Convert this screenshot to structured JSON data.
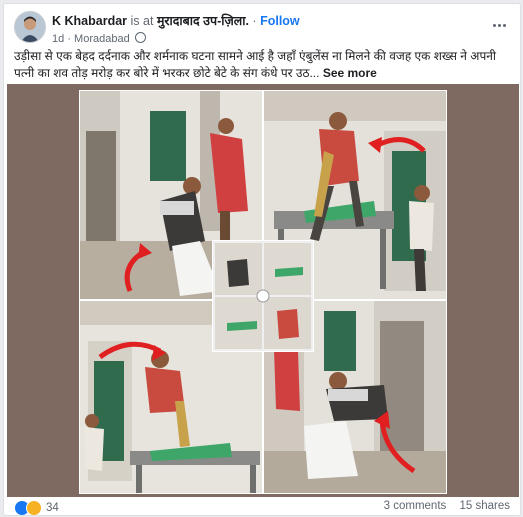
{
  "post": {
    "author": "K Khabardar",
    "connector": "is at",
    "place": "मुरादाबाद उप-ज़िला.",
    "separator": "·",
    "follow_label": "Follow",
    "time": "1d",
    "location": "Moradabad",
    "text": "उड़ीसा से एक बेहद दर्दनाक और शर्मनाक घटना सामने आई है जहाँ एंबुलेंस ना मिलने की वजह एक शख्स ने अपनी पत्नी का शव  तोड़ मरोड़ कर बोरे में भरकर छोटे बेटे के संग कंधे पर उठ...",
    "see_more": "See more",
    "reaction_count": "34",
    "comments": "3 comments",
    "shares": "15 shares"
  },
  "icons": {
    "avatar": "profile-avatar",
    "options": "more-options-icon",
    "privacy": "globe-icon",
    "like": "like-reaction-icon",
    "sad": "sad-reaction-icon",
    "annotation": "red-arrow-icon"
  },
  "colors": {
    "follow": "#1877f2",
    "arrow": "#e02020",
    "photo_background": "#7e6a60"
  }
}
